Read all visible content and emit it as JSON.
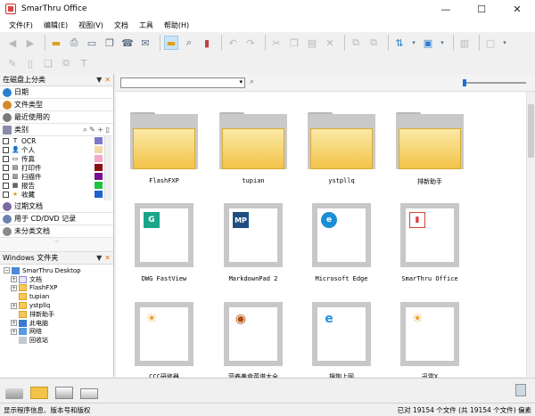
{
  "window": {
    "title": "SmarThru Office",
    "controls": [
      "—",
      "☐",
      "✕"
    ]
  },
  "menu": [
    "文件(F)",
    "编辑(E)",
    "视图(V)",
    "文档",
    "工具",
    "帮助(H)"
  ],
  "toolbar1": [
    "back-icon",
    "forward-icon",
    "sep",
    "open-folder-icon",
    "print-icon",
    "scan-icon",
    "copy-doc-icon",
    "fax-icon",
    "email-icon",
    "sep",
    "folder-view-icon",
    "search-icon",
    "book-icon",
    "sep",
    "undo-icon",
    "redo-icon",
    "sep",
    "cut-icon",
    "copy-icon",
    "paste-icon",
    "delete-icon",
    "sep",
    "move-icon",
    "copy-to-icon",
    "sep",
    "sort-icon",
    "view-mode-icon",
    "sep",
    "new-window-icon",
    "sep",
    "layout-icon"
  ],
  "toolbar2": [
    "edit-icon",
    "page-icon",
    "stack-icon",
    "duplicate-icon",
    "text-tool-icon"
  ],
  "left_panel": {
    "header": "在磁盘上分类",
    "nav_items": [
      {
        "label": "日期",
        "color": "#2a7fd4"
      },
      {
        "label": "文件类型",
        "color": "#d48a2a"
      },
      {
        "label": "最近使用的",
        "color": "#7a7a7a"
      }
    ],
    "categories_header": "类别",
    "categories": [
      {
        "label": "OCR",
        "icon": "T",
        "color": "#7b78c8"
      },
      {
        "label": "个人",
        "icon": "👤",
        "color": "#f4d9a8"
      },
      {
        "label": "传真",
        "icon": "▭",
        "color": "#f2a8c8"
      },
      {
        "label": "打印件",
        "icon": "▤",
        "color": "#8b1010"
      },
      {
        "label": "扫描件",
        "icon": "▥",
        "color": "#7a1090"
      },
      {
        "label": "报告",
        "icon": "▦",
        "color": "#22c040"
      },
      {
        "label": "收藏",
        "icon": "★",
        "color": "#2060d0"
      }
    ],
    "bottom_items": [
      {
        "label": "过期文档",
        "color": "#7a6aa0"
      },
      {
        "label": "用于 CD/DVD 记录",
        "color": "#6a80b0"
      },
      {
        "label": "未分类文档",
        "color": "#8a8a8a"
      }
    ]
  },
  "tree_panel": {
    "header": "Windows 文件夹",
    "items": [
      {
        "label": "SmarThru Desktop",
        "indent": 0,
        "expander": "−",
        "type": "desktop"
      },
      {
        "label": "文档",
        "indent": 1,
        "expander": "+",
        "type": "doc"
      },
      {
        "label": "FlashFXP",
        "indent": 1,
        "expander": "+",
        "type": "folder"
      },
      {
        "label": "tupian",
        "indent": 1,
        "expander": "",
        "type": "folder"
      },
      {
        "label": "ystpllq",
        "indent": 1,
        "expander": "+",
        "type": "folder"
      },
      {
        "label": "排新助手",
        "indent": 1,
        "expander": "",
        "type": "folder"
      },
      {
        "label": "此电脑",
        "indent": 1,
        "expander": "+",
        "type": "pc"
      },
      {
        "label": "网络",
        "indent": 1,
        "expander": "+",
        "type": "net"
      },
      {
        "label": "回收站",
        "indent": 1,
        "expander": "",
        "type": "bin"
      }
    ]
  },
  "content": {
    "search_placeholder": "",
    "folders": [
      "FlashFXP",
      "tupian",
      "ystpllq",
      "排新助手"
    ],
    "apps": [
      {
        "label": "DWG FastView",
        "icon": "G",
        "color": "#1aa58a"
      },
      {
        "label": "MarkdownPad 2",
        "icon": "MP",
        "color": "#1f4f7f"
      },
      {
        "label": "Microsoft Edge",
        "icon": "e",
        "color": "#1a8fd6"
      },
      {
        "label": "SmarThru Office",
        "icon": "▮",
        "color": "#d84040"
      }
    ],
    "apps_row3": [
      {
        "label": "CCC研修器",
        "icon": "☀",
        "color": "#f0a030"
      },
      {
        "label": "营养美食菜谱大全",
        "icon": "◉",
        "color": "#b05010"
      },
      {
        "label": "搜狗上网",
        "icon": "e",
        "color": "#2a90e0"
      },
      {
        "label": "迅雷X",
        "icon": "☀",
        "color": "#f0a030"
      }
    ]
  },
  "bottom_toolbar": [
    "scanner-icon",
    "folder-icon",
    "printer-icon",
    "printer2-icon"
  ],
  "status": {
    "left": "显示程序信息、版本号和版权",
    "right": "已对 19154 个文件 (共 19154 个文件)   偏素"
  }
}
